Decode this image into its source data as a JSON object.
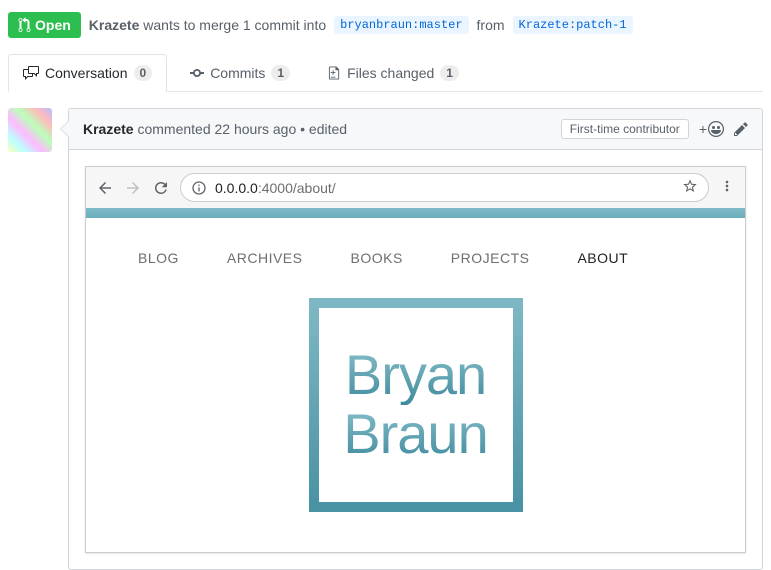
{
  "state": {
    "label": "Open"
  },
  "merge": {
    "author": "Krazete",
    "text1": "wants to merge 1 commit into",
    "base": "bryanbraun:master",
    "text2": "from",
    "head": "Krazete:patch-1"
  },
  "tabs": {
    "conversation": {
      "label": "Conversation",
      "count": "0"
    },
    "commits": {
      "label": "Commits",
      "count": "1"
    },
    "files": {
      "label": "Files changed",
      "count": "1"
    }
  },
  "comment": {
    "author": "Krazete",
    "meta": "commented 22 hours ago • edited",
    "badge": "First-time contributor"
  },
  "browser": {
    "host": "0.0.0.0",
    "port_path": ":4000/about/",
    "nav": [
      "BLOG",
      "ARCHIVES",
      "BOOKS",
      "PROJECTS",
      "ABOUT"
    ],
    "logo": {
      "line1": "Bryan",
      "line2": "Braun"
    }
  }
}
